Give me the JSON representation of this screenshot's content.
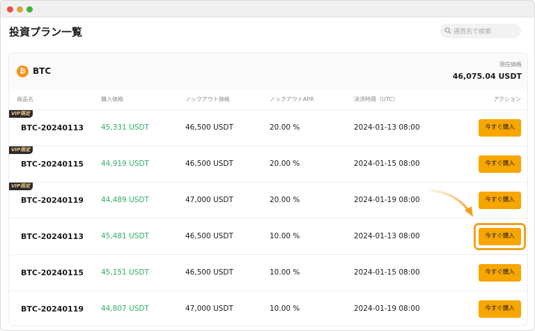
{
  "page": {
    "title": "投資プラン一覧",
    "search_placeholder": "通貨名で検索"
  },
  "coin": {
    "symbol": "BTC",
    "icon_glyph": "₿",
    "price_label": "現在価格",
    "price_value": "46,075.04 USDT"
  },
  "columns": {
    "product": "商品名",
    "buy_price": "購入価格",
    "knockout_price": "ノックアウト価格",
    "knockout_apr": "ノックアウトAPR",
    "settlement_time": "決済時間（UTC）",
    "action": "アクション"
  },
  "vip_label": "VIP限定",
  "rows": [
    {
      "vip": true,
      "name": "BTC-20240113",
      "buy": "45,331 USDT",
      "ko": "46,500 USDT",
      "apr": "20.00 %",
      "settle": "2024-01-13 08:00",
      "action": "今すぐ購入"
    },
    {
      "vip": true,
      "name": "BTC-20240115",
      "buy": "44,919 USDT",
      "ko": "46,500 USDT",
      "apr": "20.00 %",
      "settle": "2024-01-15 08:00",
      "action": "今すぐ購入"
    },
    {
      "vip": true,
      "name": "BTC-20240119",
      "buy": "44,489 USDT",
      "ko": "47,000 USDT",
      "apr": "20.00 %",
      "settle": "2024-01-19 08:00",
      "action": "今すぐ購入"
    },
    {
      "vip": false,
      "name": "BTC-20240113",
      "buy": "45,481 USDT",
      "ko": "46,500 USDT",
      "apr": "10.00 %",
      "settle": "2024-01-13 08:00",
      "action": "今すぐ購入",
      "highlighted": true
    },
    {
      "vip": false,
      "name": "BTC-20240115",
      "buy": "45,151 USDT",
      "ko": "46,500 USDT",
      "apr": "10.00 %",
      "settle": "2024-01-15 08:00",
      "action": "今すぐ購入"
    },
    {
      "vip": false,
      "name": "BTC-20240119",
      "buy": "44,807 USDT",
      "ko": "47,000 USDT",
      "apr": "10.00 %",
      "settle": "2024-01-19 08:00",
      "action": "今すぐ購入"
    }
  ],
  "colors": {
    "accent": "#f7a600",
    "buy_price": "#2eae68",
    "btc": "#f7931a"
  }
}
